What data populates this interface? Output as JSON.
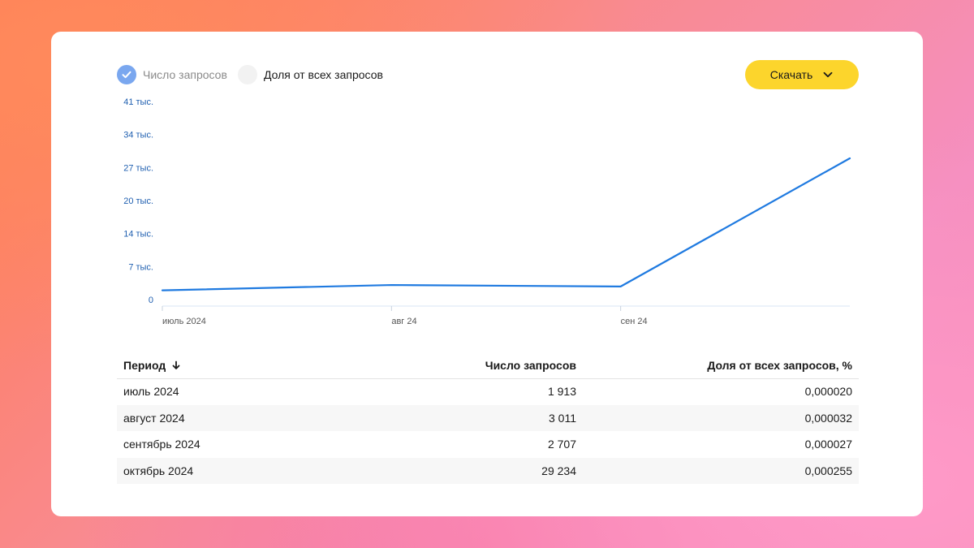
{
  "legend": {
    "series1_label": "Число запросов",
    "series2_label": "Доля от всех запросов"
  },
  "toolbar": {
    "download_label": "Скачать"
  },
  "chart_data": {
    "type": "line",
    "y_ticks": [
      "41 тыс.",
      "34 тыс.",
      "27 тыс.",
      "20 тыс.",
      "14 тыс.",
      "7 тыс.",
      "0"
    ],
    "x_ticks": [
      "июль 2024",
      "авг 24",
      "сен 24"
    ],
    "categories": [
      "июль 2024",
      "август 2024",
      "сентябрь 2024",
      "октябрь 2024"
    ],
    "series": [
      {
        "name": "Число запросов",
        "values": [
          1913,
          3011,
          2707,
          29234
        ],
        "color": "#1f7ae0"
      }
    ],
    "ylim": [
      0,
      41000
    ]
  },
  "table": {
    "headers": [
      "Период",
      "Число запросов",
      "Доля от всех запросов, %"
    ],
    "rows": [
      {
        "period": "июль 2024",
        "count": "1 913",
        "share": "0,000020"
      },
      {
        "period": "август 2024",
        "count": "3 011",
        "share": "0,000032"
      },
      {
        "period": "сентябрь 2024",
        "count": "2 707",
        "share": "0,000027"
      },
      {
        "period": "октябрь 2024",
        "count": "29 234",
        "share": "0,000255"
      }
    ]
  },
  "colors": {
    "accent": "#1f7ae0",
    "button": "#fcd52c"
  }
}
